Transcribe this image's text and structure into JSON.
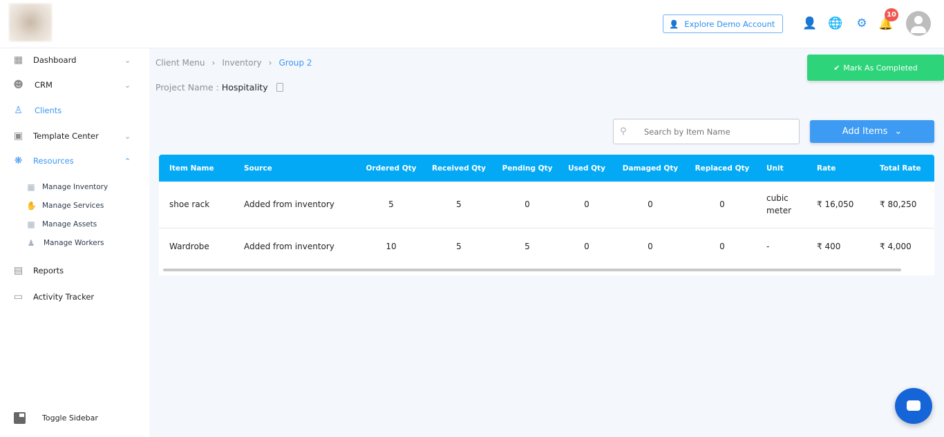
{
  "header": {
    "demo_button": "Explore Demo Account",
    "notification_count": "10"
  },
  "sidebar": {
    "items": [
      {
        "label": "Dashboard",
        "icon": "dashboard-icon"
      },
      {
        "label": "CRM",
        "icon": "crm-icon"
      },
      {
        "label": "Clients",
        "icon": "clients-icon"
      },
      {
        "label": "Template Center",
        "icon": "template-icon"
      },
      {
        "label": "Resources",
        "icon": "resources-icon"
      },
      {
        "label": "Reports",
        "icon": "reports-icon"
      },
      {
        "label": "Activity Tracker",
        "icon": "activity-icon"
      }
    ],
    "sub_items": [
      {
        "label": "Manage Inventory"
      },
      {
        "label": "Manage Services"
      },
      {
        "label": "Manage Assets"
      },
      {
        "label": "Manage Workers"
      }
    ],
    "toggle": "Toggle Sidebar"
  },
  "breadcrumb": [
    "Client Menu",
    "Inventory",
    "Group 2"
  ],
  "project": {
    "label": "Project Name :",
    "value": "Hospitality"
  },
  "mark_button": "Mark As Completed",
  "search": {
    "placeholder": "Search by Item Name"
  },
  "add_button": "Add Items",
  "table": {
    "columns": [
      "Item Name",
      "Source",
      "Ordered Qty",
      "Received Qty",
      "Pending Qty",
      "Used Qty",
      "Damaged Qty",
      "Replaced Qty",
      "Unit",
      "Rate",
      "Total Rate"
    ],
    "rows": [
      [
        "shoe rack",
        "Added from inventory",
        "5",
        "5",
        "0",
        "0",
        "0",
        "0",
        "cubic meter",
        "₹ 16,050",
        "₹ 80,250"
      ],
      [
        "Wardrobe",
        "Added from inventory",
        "10",
        "5",
        "5",
        "0",
        "0",
        "0",
        "-",
        "₹ 400",
        "₹ 4,000"
      ]
    ]
  },
  "colors": {
    "accent": "#3c96f2",
    "table_header": "#03a9f4",
    "success": "#2ed47a",
    "badge": "#f0554f"
  }
}
